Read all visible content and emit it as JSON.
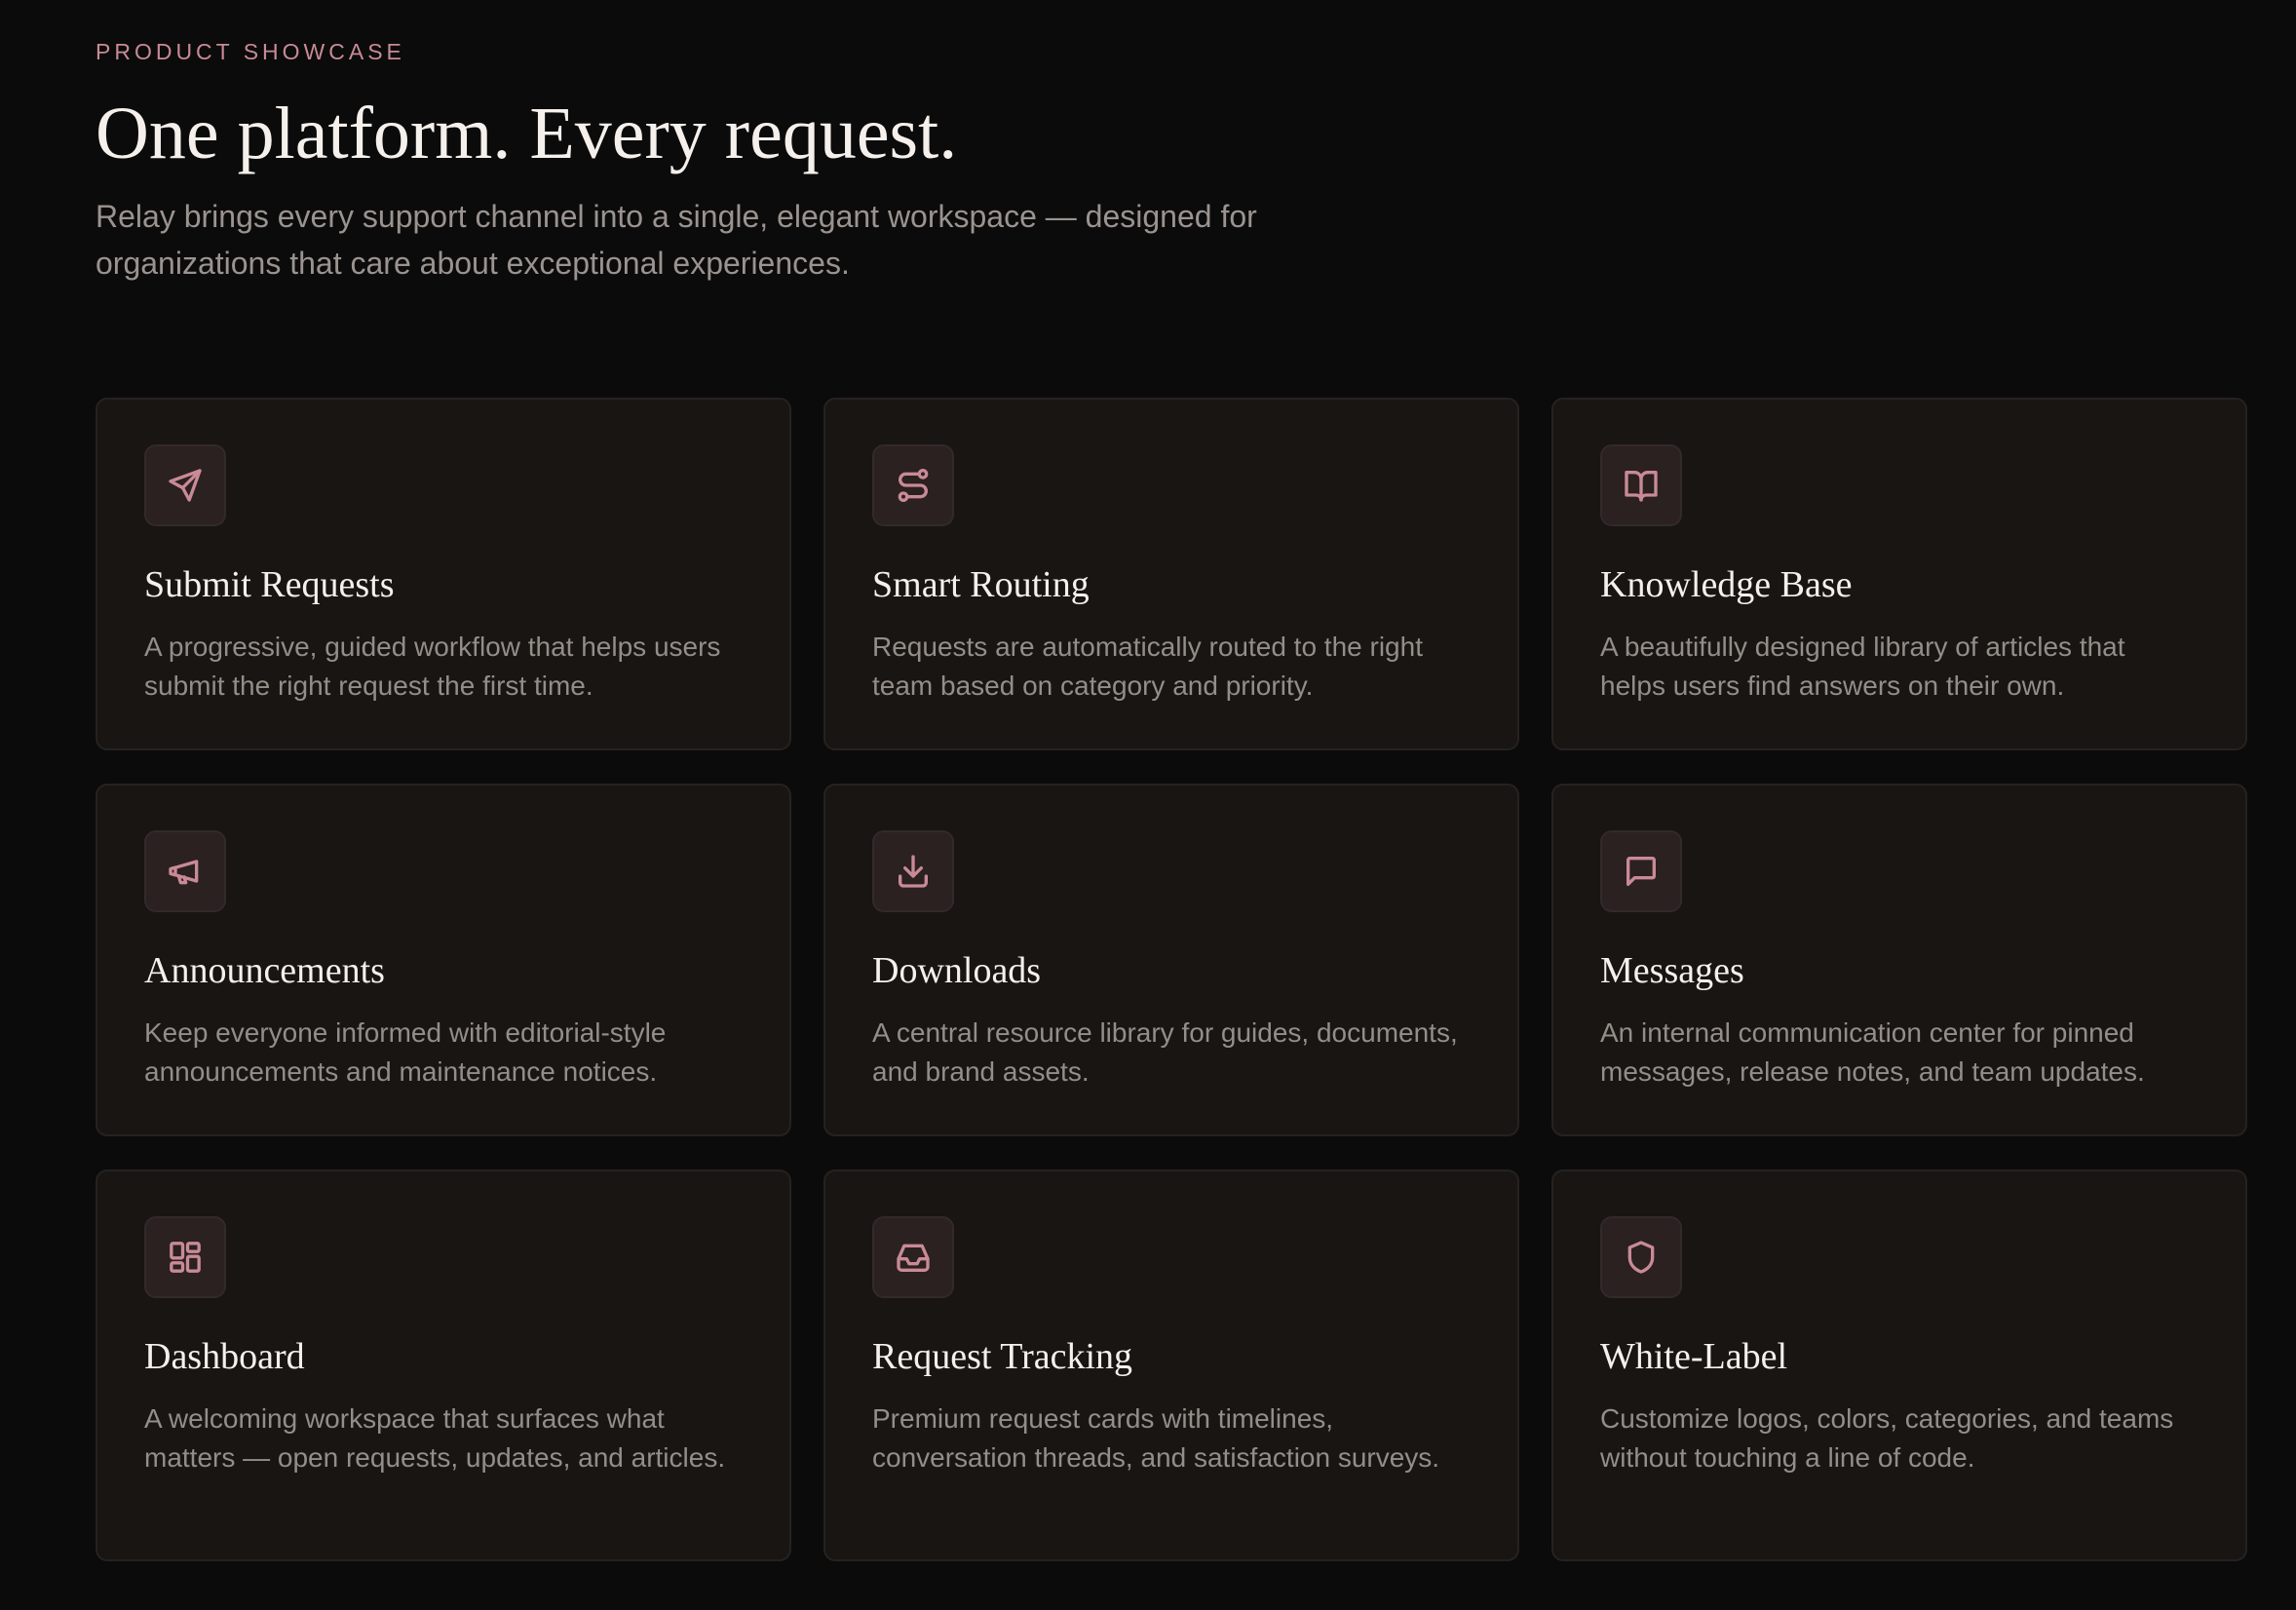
{
  "header": {
    "eyebrow": "PRODUCT SHOWCASE",
    "title": "One platform. Every request.",
    "subtitle": "Relay brings every support channel into a single, elegant workspace — designed for organizations that care about exceptional experiences."
  },
  "colors": {
    "background": "#0b0b0b",
    "card": "#181513",
    "accent": "#c98a96",
    "heading": "#f5f0ec",
    "body_text": "#948d88"
  },
  "features": [
    {
      "icon": "send-icon",
      "title": "Submit Requests",
      "description": "A progressive, guided workflow that helps users submit the right request the first time."
    },
    {
      "icon": "route-icon",
      "title": "Smart Routing",
      "description": "Requests are automatically routed to the right team based on category and priority."
    },
    {
      "icon": "book-open-icon",
      "title": "Knowledge Base",
      "description": "A beautifully designed library of articles that helps users find answers on their own."
    },
    {
      "icon": "megaphone-icon",
      "title": "Announcements",
      "description": "Keep everyone informed with editorial-style announcements and maintenance notices."
    },
    {
      "icon": "download-icon",
      "title": "Downloads",
      "description": "A central resource library for guides, documents, and brand assets."
    },
    {
      "icon": "message-square-icon",
      "title": "Messages",
      "description": "An internal communication center for pinned messages, release notes, and team updates."
    },
    {
      "icon": "dashboard-icon",
      "title": "Dashboard",
      "description": "A welcoming workspace that surfaces what matters — open requests, updates, and articles."
    },
    {
      "icon": "inbox-icon",
      "title": "Request Tracking",
      "description": "Premium request cards with timelines, conversation threads, and satisfaction surveys."
    },
    {
      "icon": "shield-icon",
      "title": "White-Label",
      "description": "Customize logos, colors, categories, and teams without touching a line of code."
    }
  ]
}
